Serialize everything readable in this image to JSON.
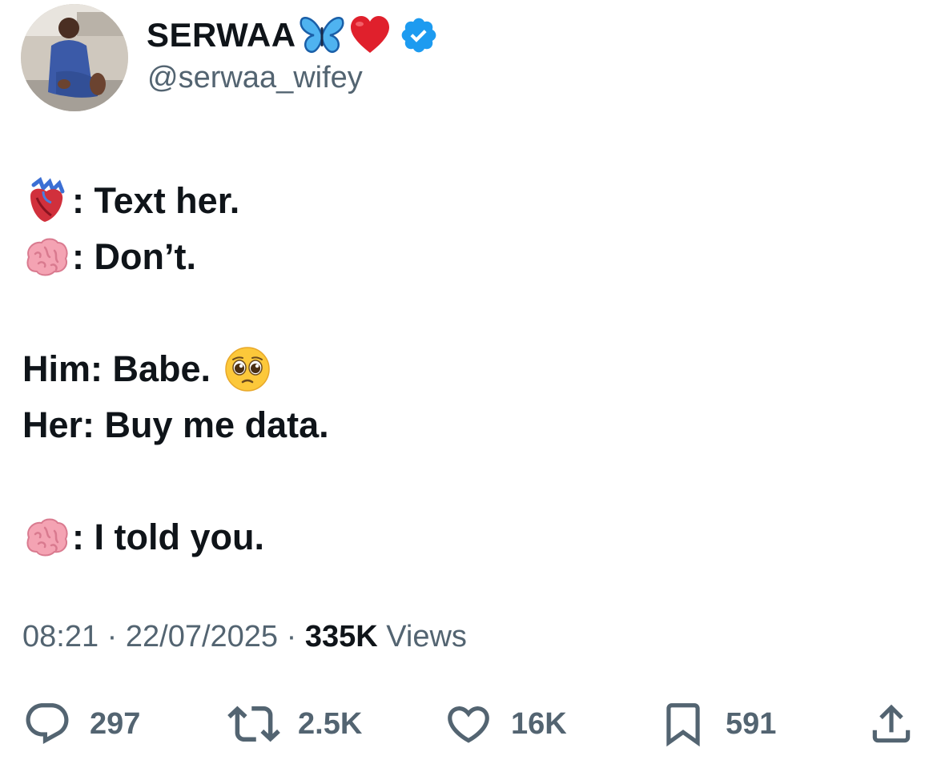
{
  "author": {
    "display_name": "SERWAA",
    "name_emojis": [
      "butterfly-icon",
      "red-heart-icon"
    ],
    "verified": true,
    "handle": "@serwaa_wifey"
  },
  "tweet": {
    "lines": [
      {
        "emoji": "anatomical-heart-icon",
        "text": ": Text her."
      },
      {
        "emoji": "brain-icon",
        "text": ": Don’t."
      },
      {
        "text": "Him: Babe.",
        "emoji_after": "pleading-face-icon"
      },
      {
        "text": "Her: Buy me data."
      },
      {
        "emoji": "brain-icon",
        "text": ": I told you."
      }
    ]
  },
  "meta": {
    "time": "08:21",
    "separator": "·",
    "date": "22/07/2025",
    "views_count": "335K",
    "views_label": "Views"
  },
  "actions": {
    "replies": "297",
    "reposts": "2.5K",
    "likes": "16K",
    "bookmarks": "591"
  },
  "colors": {
    "text": "#0f1419",
    "secondary": "#536471",
    "verified": "#1d9bf0"
  }
}
